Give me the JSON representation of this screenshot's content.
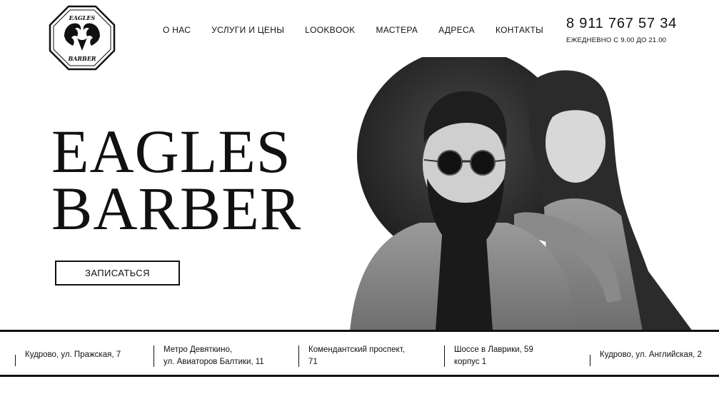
{
  "logo": {
    "top_text": "EAGLES",
    "bottom_text": "BARBER",
    "icon": "eagle-logo-icon"
  },
  "nav": {
    "items": [
      {
        "label": "О НАС"
      },
      {
        "label": "УСЛУГИ И ЦЕНЫ"
      },
      {
        "label": "LOOKBOOK"
      },
      {
        "label": "МАСТЕРА"
      },
      {
        "label": "АДРЕСА"
      },
      {
        "label": "КОНТАКТЫ"
      }
    ]
  },
  "contact": {
    "phone": "8 911 767 57 34",
    "hours": "ЕЖЕДНЕВНО С 9.00 ДО 21.00"
  },
  "hero": {
    "title_line1": "EAGLES",
    "title_line2": "BARBER",
    "book_button": "ЗАПИСАТЬСЯ"
  },
  "addresses": [
    {
      "line1": "Кудрово, ул. Пражская, 7",
      "line2": ""
    },
    {
      "line1": "Метро Девяткино,",
      "line2": "ул. Авиаторов Балтики, 11"
    },
    {
      "line1": "Комендантский проспект,",
      "line2": "71"
    },
    {
      "line1": "Шоссе в Лаврики, 59",
      "line2": "корпус 1"
    },
    {
      "line1": "Кудрово, ул. Английская, 2",
      "line2": ""
    }
  ],
  "colors": {
    "text": "#111111",
    "background": "#ffffff",
    "photo_circle": "#2a2a2a"
  }
}
